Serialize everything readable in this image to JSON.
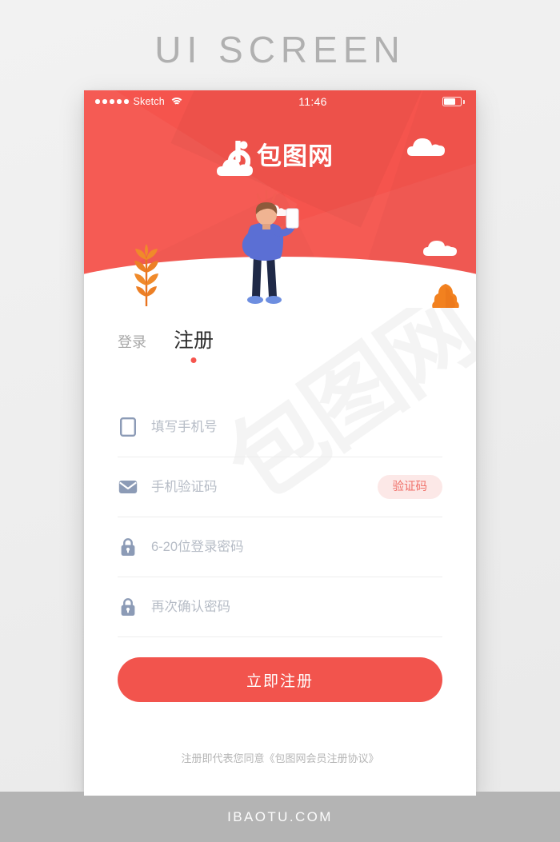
{
  "page": {
    "caption": "UI SCREEN",
    "footer_watermark": "IBAOTU.COM",
    "background_color": "#eeeeee",
    "band_color": "#b4b4b4"
  },
  "status_bar": {
    "carrier": "Sketch",
    "signal_dots": 5,
    "wifi_icon": "wifi-icon",
    "time": "11:46",
    "battery_icon": "battery-icon",
    "battery_level": "72%"
  },
  "brand": {
    "logo_icon": "baotu-logo-icon",
    "name": "包图网"
  },
  "hero": {
    "background_color": "#f5544d",
    "illustration": {
      "person": "person-holding-phone-illustration",
      "clouds": [
        "cloud-left",
        "cloud-top-right",
        "cloud-mid-right"
      ],
      "leaves": [
        "leaf-left-orange",
        "leaf-right-orange"
      ]
    }
  },
  "form": {
    "watermark": "包图网",
    "tabs": [
      {
        "label": "登录",
        "active": false
      },
      {
        "label": "注册",
        "active": true
      }
    ],
    "fields": [
      {
        "icon": "phone-icon",
        "placeholder": "填写手机号",
        "value": "",
        "type": "tel"
      },
      {
        "icon": "envelope-icon",
        "placeholder": "手机验证码",
        "value": "",
        "type": "text",
        "action_label": "验证码"
      },
      {
        "icon": "lock-icon",
        "placeholder": "6-20位登录密码",
        "value": "",
        "type": "password"
      },
      {
        "icon": "lock-icon",
        "placeholder": "再次确认密码",
        "value": "",
        "type": "password"
      }
    ],
    "submit_label": "立即注册",
    "agreement_prefix": "注册即代表您同意",
    "agreement_link": "《包图网会员注册协议》"
  },
  "colors": {
    "accent": "#f5544d",
    "accent_button": "#f2544d",
    "code_button_bg": "#fce8e7",
    "code_button_text": "#f07069",
    "icon_gray": "#8c9bb6",
    "placeholder": "#b6bcc6",
    "tab_inactive": "#a8a8a8",
    "tab_active": "#2d2d2d"
  }
}
